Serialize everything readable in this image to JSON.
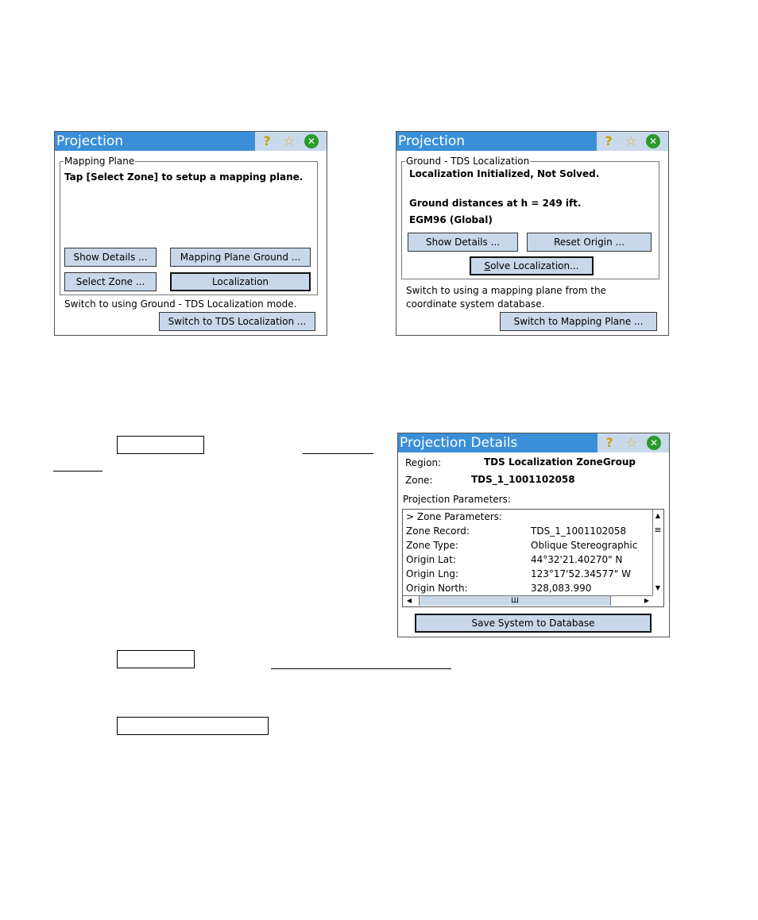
{
  "window1": {
    "title": "Projection",
    "group": "Mapping Plane",
    "message": "Tap [Select Zone] to setup a mapping plane.",
    "btn_show_details": "Show Details ...",
    "btn_mapping_plane_ground": "Mapping Plane Ground ...",
    "btn_select_zone": "Select Zone ...",
    "btn_localization": "Localization",
    "switch_text": "Switch to using  Ground - TDS Localization mode.",
    "btn_switch": "Switch to TDS Localization ..."
  },
  "window2": {
    "title": "Projection",
    "group": "Ground - TDS Localization",
    "status": "Localization Initialized, Not Solved.",
    "ground_distances": "Ground distances at h = 249  ift.",
    "geoid": "EGM96 (Global)",
    "btn_show_details": "Show Details ...",
    "btn_reset_origin": "Reset Origin ...",
    "btn_solve_mnemonic": "S",
    "btn_solve_rest": "olve Localization...",
    "switch_text_1": "Switch to using a mapping plane from the",
    "switch_text_2": "coordinate system database.",
    "btn_switch": "Switch to Mapping Plane ..."
  },
  "window3": {
    "title": "Projection Details",
    "region_label": "Region:",
    "region_value": "TDS Localization ZoneGroup",
    "zone_label": "Zone:",
    "zone_value": "TDS_1_1001102058",
    "params_label": "Projection Parameters:",
    "params": [
      {
        "label": "> Zone Parameters:",
        "value": ""
      },
      {
        "label": "Zone Record:",
        "value": "TDS_1_1001102058"
      },
      {
        "label": "Zone Type:",
        "value": "Oblique Stereographic"
      },
      {
        "label": "Origin Lat:",
        "value": "44°32'21.40270\" N"
      },
      {
        "label": "Origin Lng:",
        "value": "123°17'52.34577\" W"
      },
      {
        "label": "Origin North:",
        "value": "328,083.990"
      }
    ],
    "hscroll_grip": "Ш",
    "btn_save": "Save System to Database"
  },
  "icons": {
    "help": "?",
    "star": "☆",
    "close": "✕",
    "scroll_up": "▲",
    "scroll_down": "▼",
    "scroll_left": "◀",
    "scroll_right": "▶",
    "scroll_grip": "≡"
  },
  "colors": {
    "titlebar": "#3a8fd8",
    "button": "#c8d8ea"
  }
}
